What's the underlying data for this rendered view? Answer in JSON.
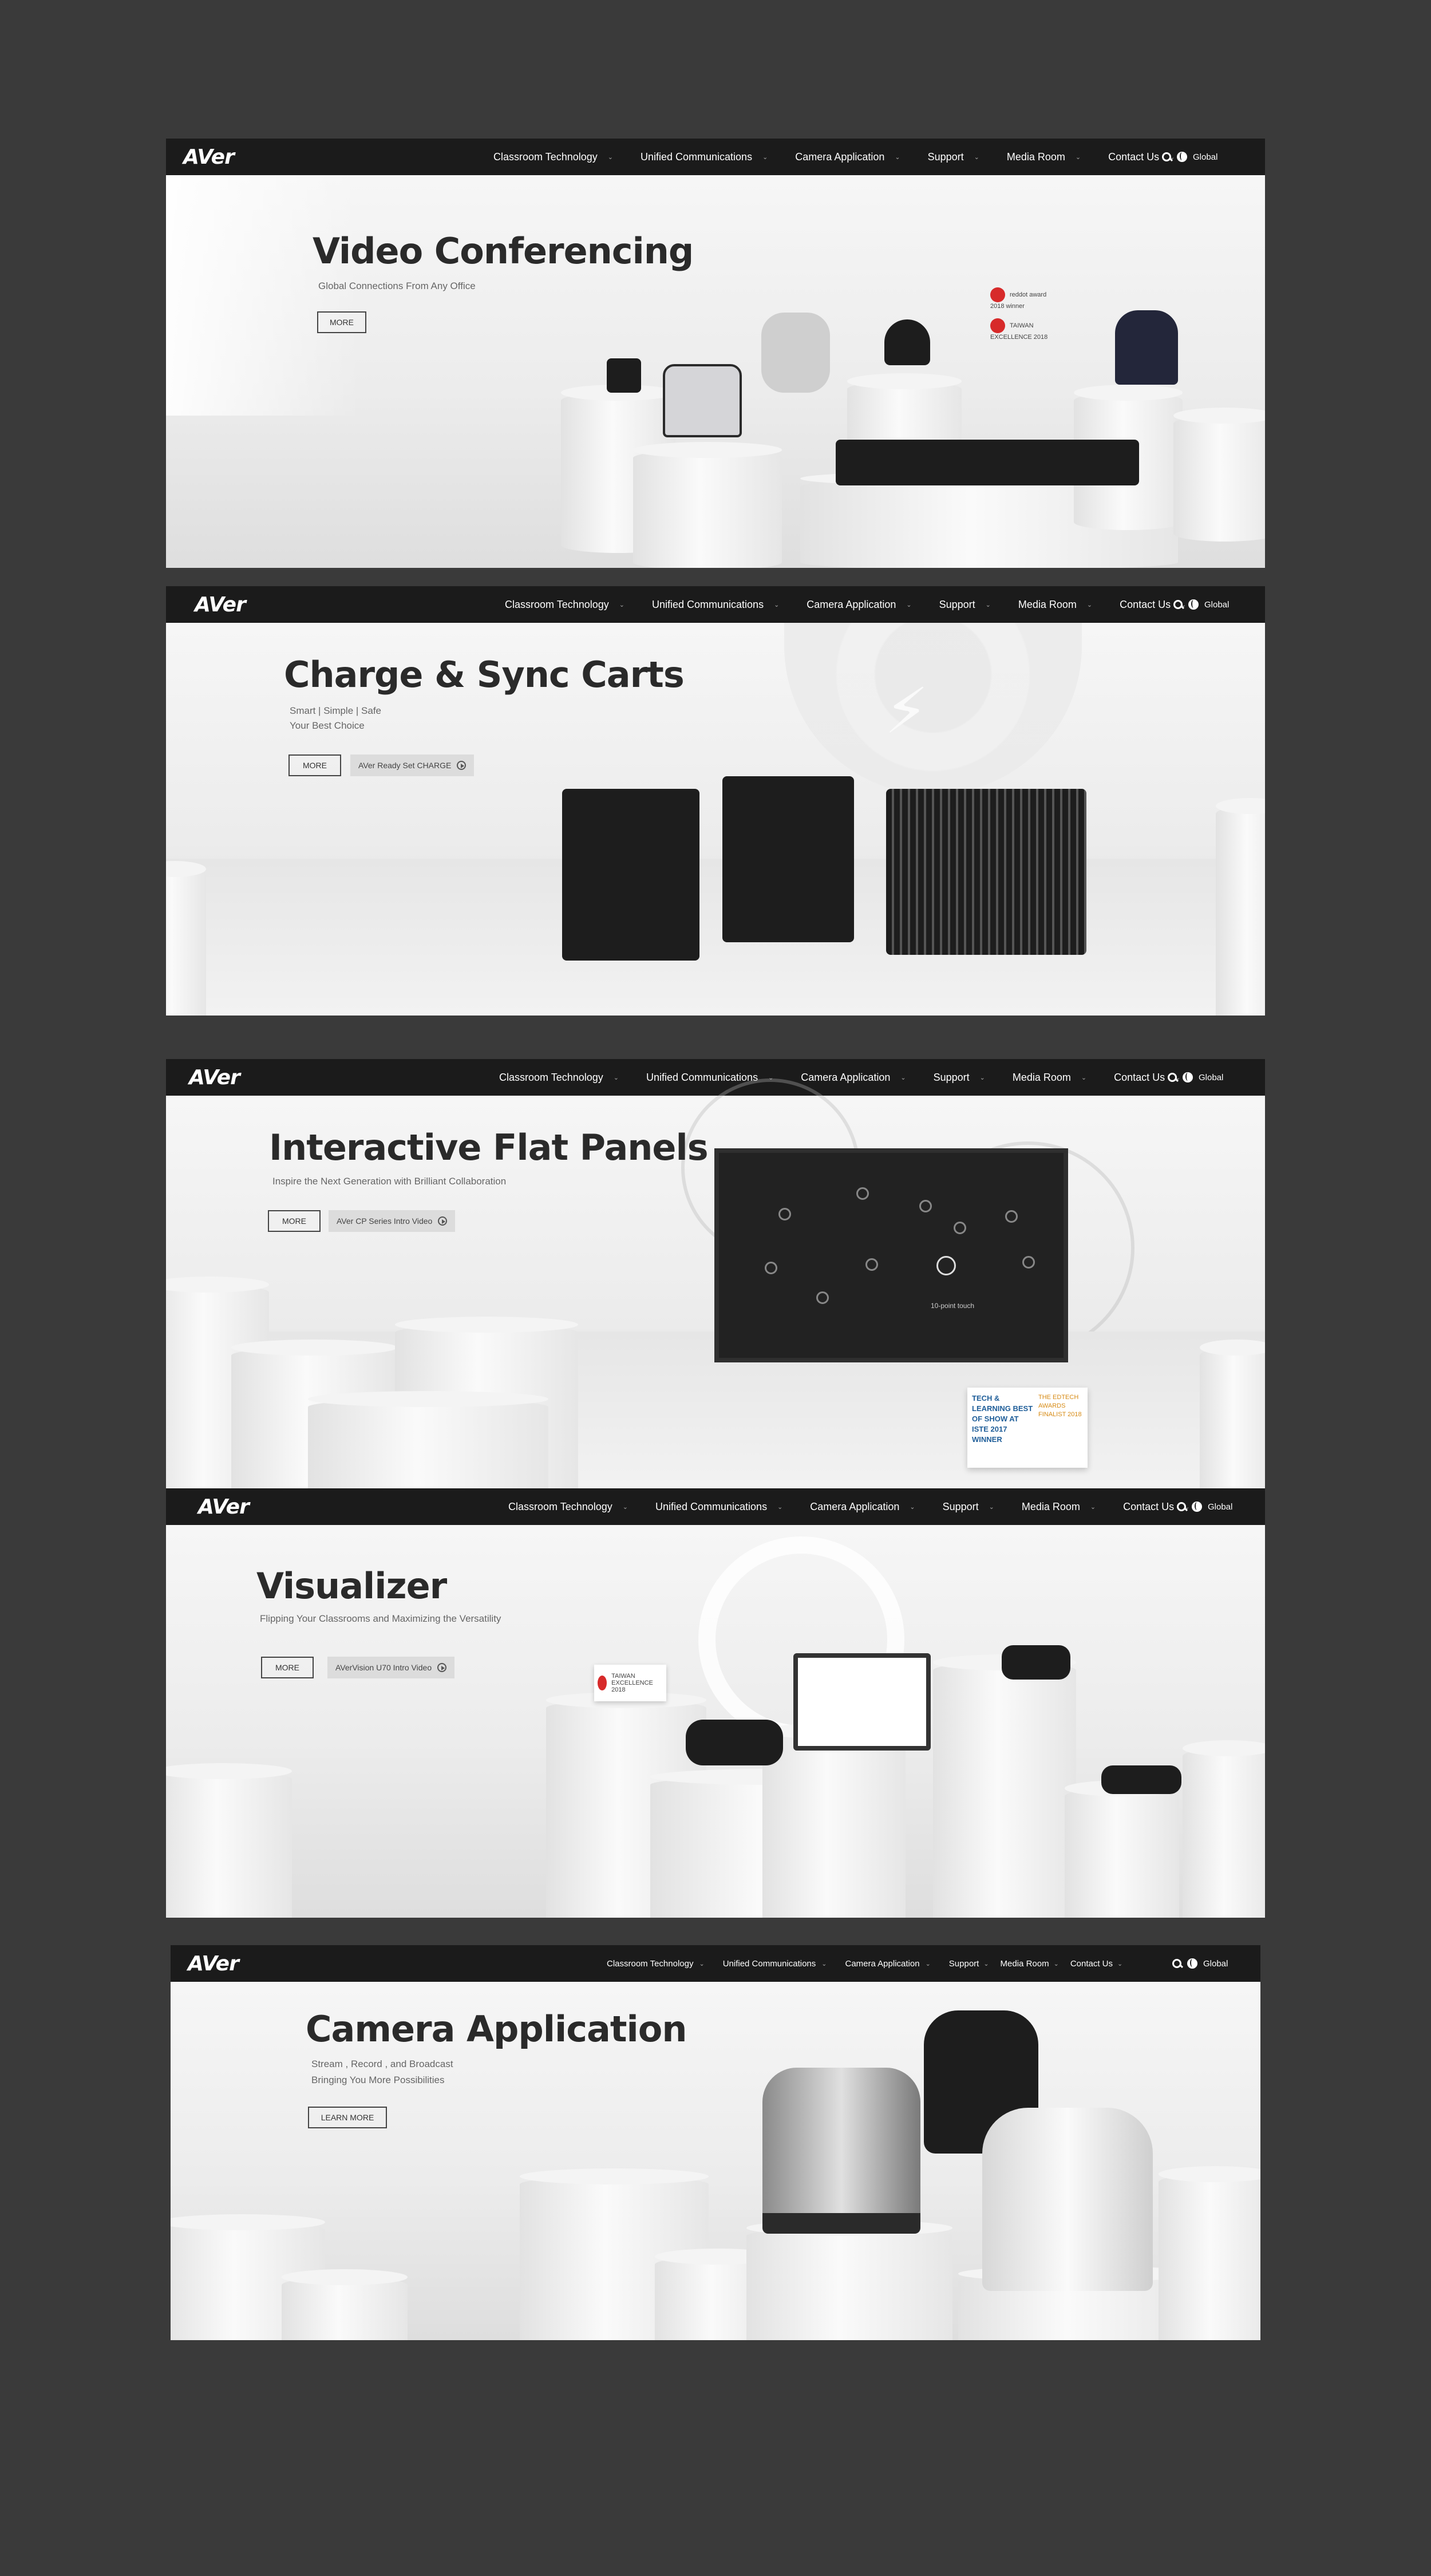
{
  "nav": {
    "logo": "AVer",
    "items": [
      "Classroom Technology",
      "Unified Communications",
      "Camera Application",
      "Support",
      "Media Room",
      "Contact Us"
    ],
    "global_label": "Global",
    "caret": "⌄"
  },
  "panels": {
    "video": {
      "title": "Video Conferencing",
      "subtitle": "Global Connections From Any Office",
      "more": "MORE",
      "award_red_dot": "reddot award 2018 winner",
      "award_taiwan": "TAIWAN EXCELLENCE 2018"
    },
    "carts": {
      "title": "Charge & Sync Carts",
      "subtitle1": "Smart | Simple | Safe",
      "subtitle2": "Your Best Choice",
      "more": "MORE",
      "secondary": "AVer Ready Set CHARGE"
    },
    "panels_ifp": {
      "title": "Interactive Flat Panels",
      "subtitle": "Inspire the Next Generation with Brilliant Collaboration",
      "more": "MORE",
      "secondary": "AVer CP Series Intro Video",
      "touch_label": "10-point touch",
      "award1": "TECH & LEARNING BEST OF SHOW AT ISTE 2017 WINNER",
      "award2": "THE EDTECH AWARDS FINALIST 2018"
    },
    "visualizer": {
      "title": "Visualizer",
      "subtitle": "Flipping Your Classrooms and Maximizing the Versatility",
      "more": "MORE",
      "secondary": "AVerVision U70 Intro Video",
      "award_taiwan": "TAIWAN EXCELLENCE 2018"
    },
    "camera": {
      "title": "Camera Application",
      "subtitle1": "Stream , Record , and Broadcast",
      "subtitle2": "Bringing You More Possibilities",
      "learn_more": "LEARN MORE"
    }
  },
  "colors": {
    "background": "#3a3a3a",
    "nav": "#1b1b1b",
    "accent_red": "#d72a2a"
  }
}
